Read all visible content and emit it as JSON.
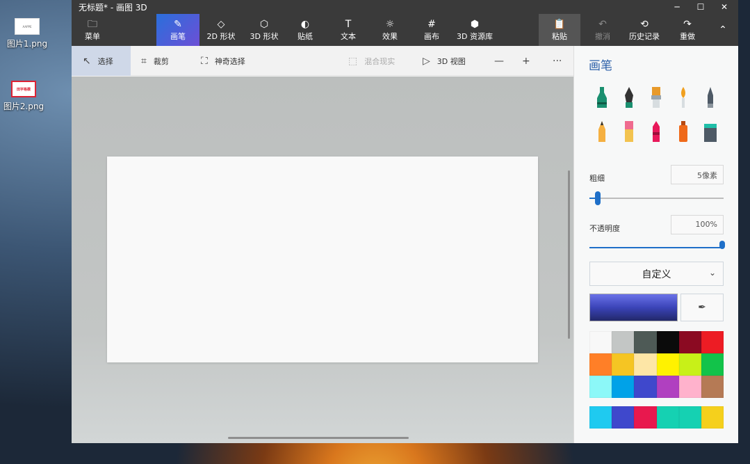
{
  "window": {
    "title": "无标题* - 画图 3D"
  },
  "desktop": {
    "icons": [
      {
        "label": "图片1.png",
        "thumb_text": "AAPPE"
      },
      {
        "label": "图片2.png",
        "thumb_text": "田字格模"
      }
    ]
  },
  "ribbon": {
    "menu": "菜单",
    "tabs": [
      {
        "label": "画笔",
        "icon": "brush-icon"
      },
      {
        "label": "2D 形状",
        "icon": "shapes-2d-icon"
      },
      {
        "label": "3D 形状",
        "icon": "cube-icon"
      },
      {
        "label": "贴纸",
        "icon": "sticker-icon"
      },
      {
        "label": "文本",
        "icon": "text-icon"
      },
      {
        "label": "效果",
        "icon": "sun-icon"
      },
      {
        "label": "画布",
        "icon": "canvas-icon"
      },
      {
        "label": "3D 资源库",
        "icon": "library-icon"
      }
    ],
    "paste": "粘贴",
    "undo": "撤消",
    "history": "历史记录",
    "redo": "重做"
  },
  "toolbar": {
    "select": "选择",
    "crop": "裁剪",
    "magic_select": "神奇选择",
    "mixed_reality": "混合现实",
    "view_3d": "3D 视图"
  },
  "panel": {
    "title": "画笔",
    "thickness_label": "粗细",
    "thickness_value": "5像素",
    "thickness_fraction": 0.05,
    "opacity_label": "不透明度",
    "opacity_value": "100%",
    "opacity_fraction": 1.0,
    "color_mode": "自定义",
    "current_color": "#3b44b8",
    "palette": [
      "#f8f8f8",
      "#c3c6c5",
      "#4e5a56",
      "#0b0b0b",
      "#8b0a22",
      "#ed1c24",
      "#ff7f27",
      "#f5c523",
      "#fde6a6",
      "#fff200",
      "#c8f018",
      "#12c34a",
      "#8cf8f8",
      "#00a2e8",
      "#3f48cc",
      "#b040c0",
      "#ffb2cc",
      "#b57a55"
    ],
    "custom_colors": [
      "#1fcaf0",
      "#3f48cc",
      "#e8184e",
      "#15d1b2",
      "#15d1b2",
      "#f5d01c"
    ]
  }
}
